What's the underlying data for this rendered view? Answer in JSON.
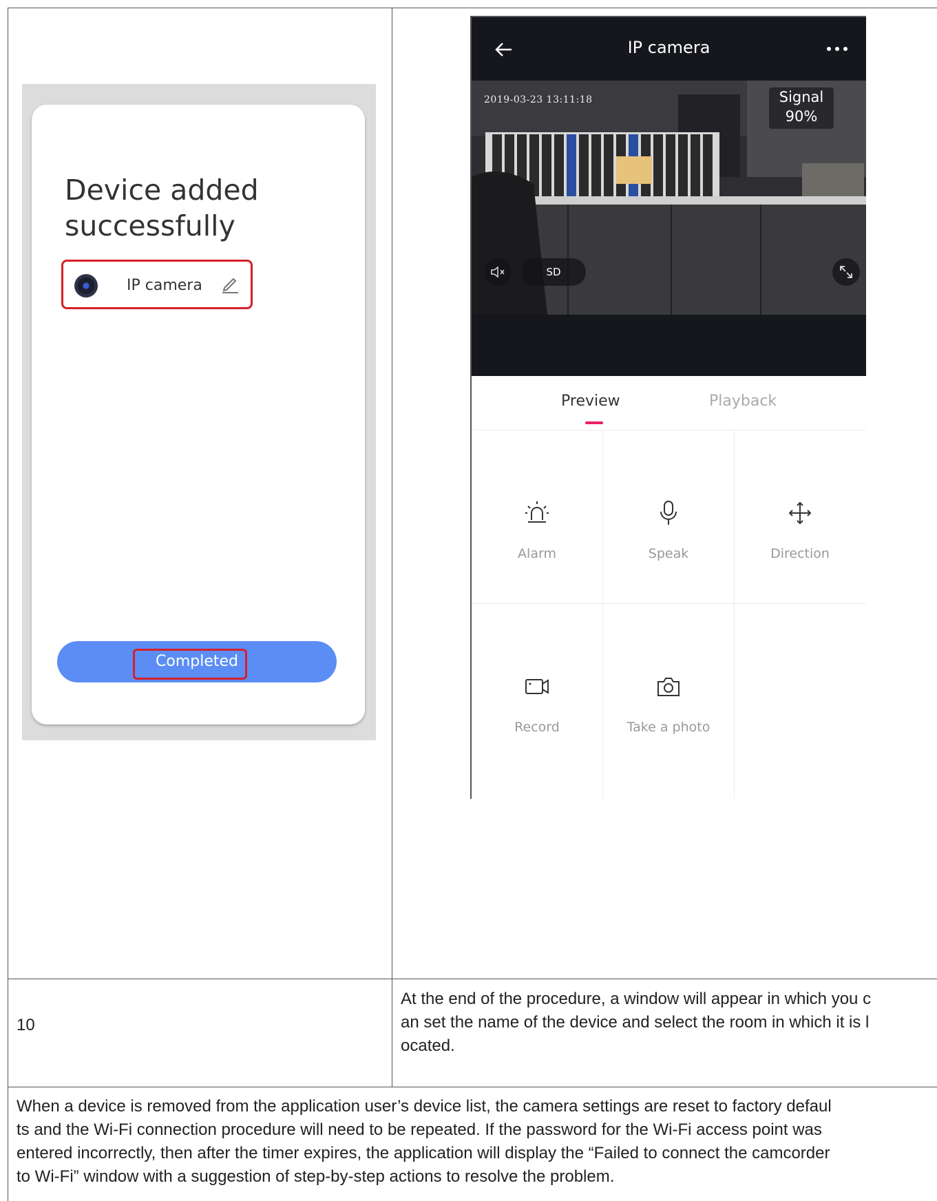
{
  "left_screen": {
    "title": "Device added successfully",
    "device_name": "IP camera",
    "button_label": "Completed"
  },
  "right_screen": {
    "title": "IP camera",
    "timestamp": "2019-03-23 13:11:18",
    "signal_line1": "Signal",
    "signal_line2": "90%",
    "quality_label": "SD",
    "tabs": [
      "Preview",
      "Playback"
    ],
    "controls": [
      "Alarm",
      "Speak",
      "Direction",
      "Record",
      "Take a photo"
    ]
  },
  "row": {
    "number": "10",
    "description": "At the end of the procedure, a window will appear in which you c\nan set the name of the device and select the room in which it is l\nocated."
  },
  "note": "When a device is removed from the application user’s device list, the camera settings are reset to factory defaul\nts and the Wi-Fi connection procedure will need to be repeated. If the password for the Wi-Fi access point was\nentered incorrectly, then after the timer expires, the application will display the “Failed to connect the camcorder\nto Wi-Fi” window with a suggestion of step-by-step actions to resolve the problem.",
  "colors": {
    "highlight_red": "#d6202a",
    "button_blue": "#5b8df5",
    "tab_accent": "#e91e63",
    "appbar_dark": "#15171d"
  }
}
